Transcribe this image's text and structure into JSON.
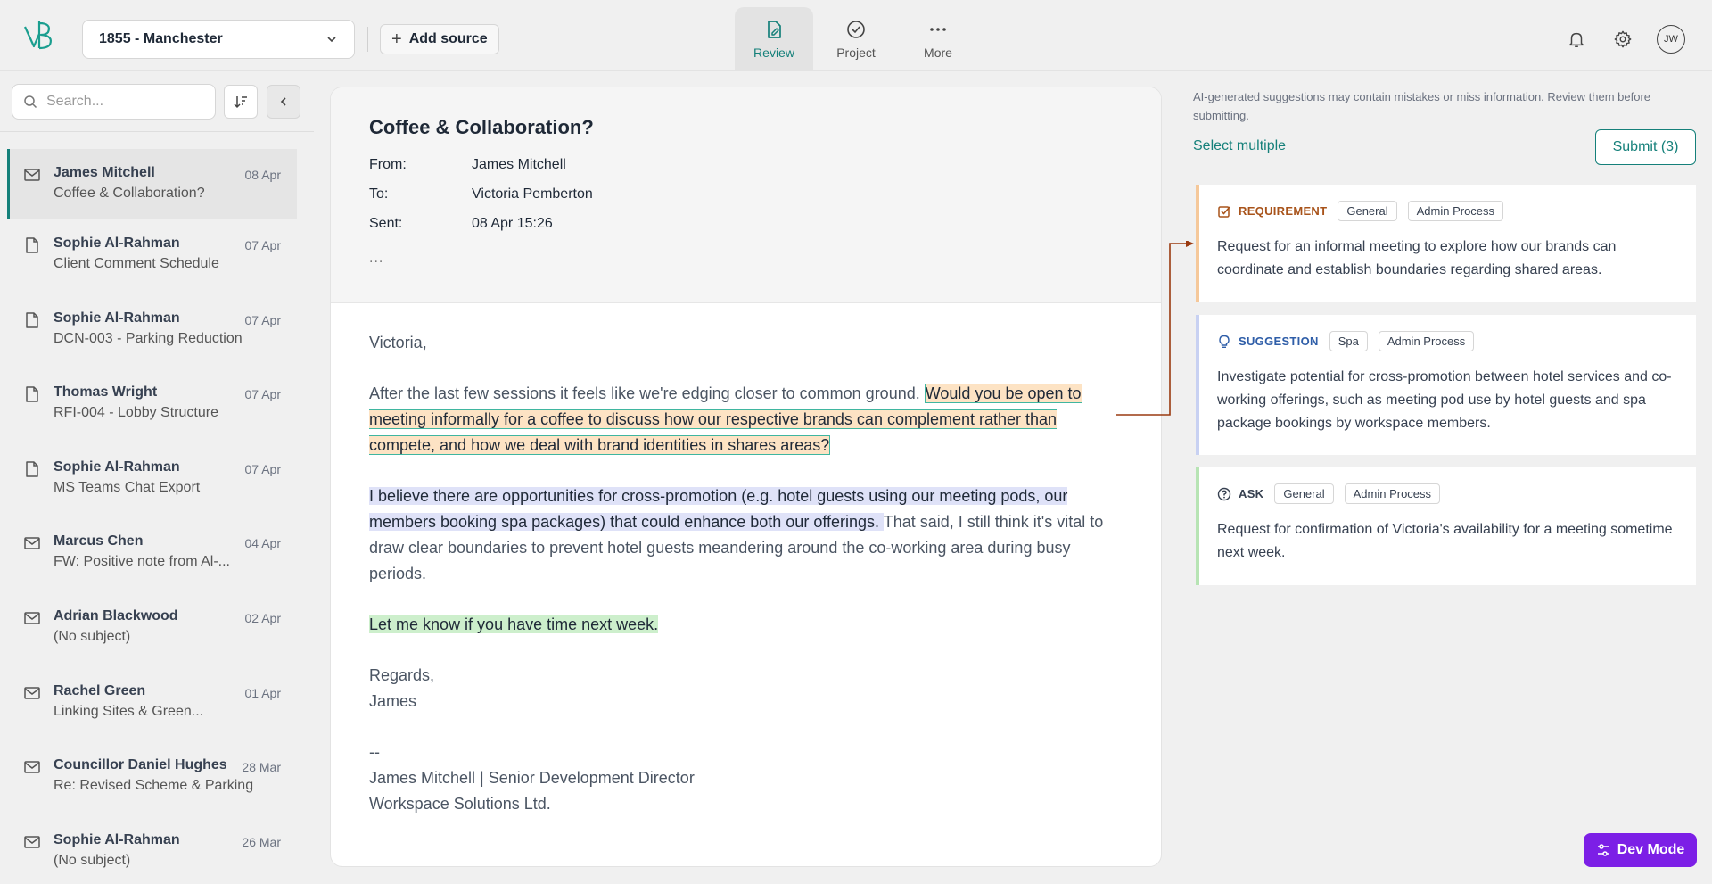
{
  "topbar": {
    "project": "1855 - Manchester",
    "add_source": "Add source",
    "nav": [
      {
        "label": "Review",
        "icon": "review-doc-icon",
        "active": true
      },
      {
        "label": "Project",
        "icon": "check-circle-icon",
        "active": false
      },
      {
        "label": "More",
        "icon": "more-dots-icon",
        "active": false
      }
    ],
    "avatar": "JW"
  },
  "sidebar": {
    "search_placeholder": "Search...",
    "items": [
      {
        "type": "email",
        "sender": "James Mitchell",
        "subject": "Coffee & Collaboration?",
        "date": "08 Apr",
        "active": true
      },
      {
        "type": "document",
        "sender": "Sophie Al-Rahman",
        "subject": "Client Comment Schedule",
        "date": "07 Apr"
      },
      {
        "type": "document",
        "sender": "Sophie Al-Rahman",
        "subject": "DCN-003 - Parking Reduction",
        "date": "07 Apr"
      },
      {
        "type": "document",
        "sender": "Thomas Wright",
        "subject": "RFI-004 - Lobby Structure",
        "date": "07 Apr"
      },
      {
        "type": "document",
        "sender": "Sophie Al-Rahman",
        "subject": "MS Teams Chat Export",
        "date": "07 Apr"
      },
      {
        "type": "email",
        "sender": "Marcus Chen",
        "subject": "FW: Positive note from Al-...",
        "date": "04 Apr"
      },
      {
        "type": "email",
        "sender": "Adrian Blackwood",
        "subject": "(No subject)",
        "date": "02 Apr"
      },
      {
        "type": "email",
        "sender": "Rachel Green",
        "subject": "Linking Sites & Green...",
        "date": "01 Apr"
      },
      {
        "type": "email",
        "sender": "Councillor Daniel Hughes",
        "subject": "Re: Revised Scheme & Parking",
        "date": "28 Mar"
      },
      {
        "type": "email",
        "sender": "Sophie Al-Rahman",
        "subject": "(No subject)",
        "date": "26 Mar"
      }
    ]
  },
  "email": {
    "title": "Coffee & Collaboration?",
    "from_label": "From:",
    "from": "James Mitchell",
    "to_label": "To:",
    "to": "Victoria Pemberton",
    "sent_label": "Sent:",
    "sent": "08 Apr 15:26",
    "more": "...",
    "greeting": "Victoria,",
    "p1_plain": "After the last few sessions it feels like we're edging closer to common ground. ",
    "p1_highlight": "Would you be open to meeting informally for a coffee to discuss how our respective brands can complement rather than compete, and how we deal with brand identities in shares areas?",
    "p2_highlight": "I believe there are opportunities for cross-promotion (e.g. hotel guests using our meeting pods, our members booking spa packages) that could enhance both our offerings. ",
    "p2_plain": "That said, I still think it's vital to draw clear boundaries to prevent hotel guests meandering around the co-working area during busy periods.",
    "p3_highlight": "Let me know if you have time next week.",
    "closing": "Regards,",
    "name": "James",
    "sig_dash": "--",
    "sig_line1": "James Mitchell | Senior Development Director",
    "sig_line2": "Workspace Solutions Ltd."
  },
  "panel": {
    "disclaimer": "AI-generated suggestions may contain mistakes or miss information. Review them before submitting.",
    "select_multiple": "Select multiple",
    "submit": "Submit (3)",
    "cards": [
      {
        "type": "REQUIREMENT",
        "icon": "checkbox-icon",
        "color": "#a8531a",
        "border": "#f5c89a",
        "tags": [
          "General",
          "Admin Process"
        ],
        "desc": "Request for an informal meeting to explore how our brands can coordinate and establish boundaries regarding shared areas."
      },
      {
        "type": "SUGGESTION",
        "icon": "lightbulb-icon",
        "color": "#2f5ea8",
        "border": "#c8d1f2",
        "tags": [
          "Spa",
          "Admin Process"
        ],
        "desc": "Investigate potential for cross-promotion between hotel services and co-working offerings, such as meeting pod use by hotel guests and spa package bookings by workspace members."
      },
      {
        "type": "ASK",
        "icon": "question-circle-icon",
        "color": "#374151",
        "border": "#b7e4b4",
        "tags": [
          "General",
          "Admin Process"
        ],
        "desc": "Request for confirmation of Victoria's availability for a meeting sometime next week."
      }
    ]
  },
  "dev_mode": "Dev Mode"
}
